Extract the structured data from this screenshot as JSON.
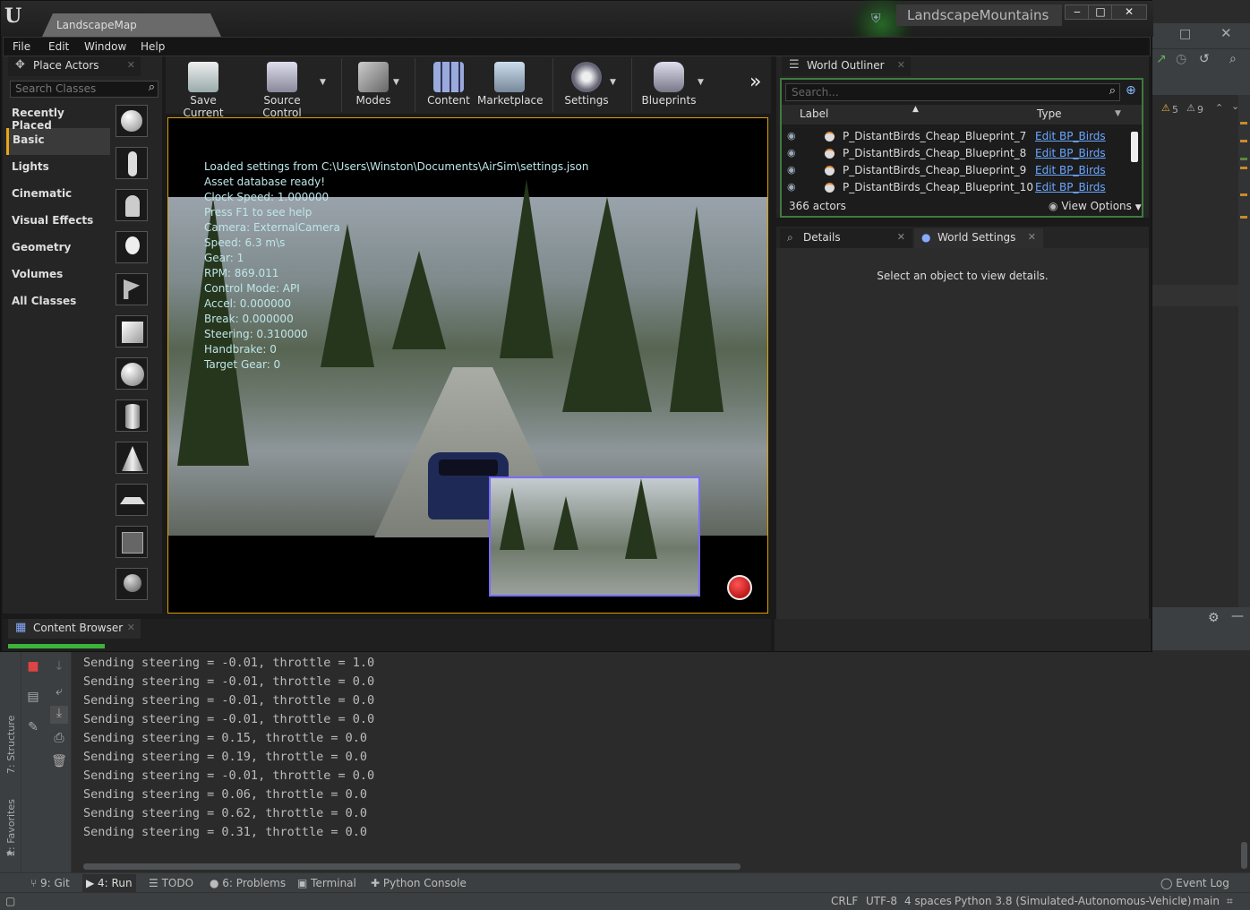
{
  "ue": {
    "tab_title": "LandscapeMap",
    "project_name": "LandscapeMountains",
    "window_controls": [
      "‒",
      "□",
      "✕"
    ],
    "menu": [
      "File",
      "Edit",
      "Window",
      "Help"
    ]
  },
  "place_actors": {
    "tab_label": "Place Actors",
    "search_placeholder": "Search Classes",
    "categories": [
      "Recently Placed",
      "Basic",
      "Lights",
      "Cinematic",
      "Visual Effects",
      "Geometry",
      "Volumes",
      "All Classes"
    ],
    "active_category": "Basic"
  },
  "toolbar": {
    "save_current": "Save Current",
    "source_control": "Source Control",
    "modes": "Modes",
    "content": "Content",
    "marketplace": "Marketplace",
    "settings": "Settings",
    "blueprints": "Blueprints",
    "more": "»"
  },
  "viewport": {
    "overlay_lines": [
      "Loaded settings from C:\\Users\\Winston\\Documents\\AirSim\\settings.json",
      "Asset database ready!",
      "Clock Speed: 1.000000",
      "Press F1 to see help",
      "Camera: ExternalCamera",
      "Speed: 6.3 m\\s",
      "Gear: 1",
      "RPM: 869.011",
      "Control Mode: API",
      "Accel: 0.000000",
      "Break: 0.000000",
      "Steering: 0.310000",
      "Handbrake: 0",
      "Target Gear: 0"
    ]
  },
  "outliner": {
    "tab_label": "World Outliner",
    "search_placeholder": "Search...",
    "col_label": "Label",
    "col_type": "Type",
    "rows": [
      {
        "label": "P_DistantBirds_Cheap_Blueprint_7",
        "type": "Edit BP_Birds"
      },
      {
        "label": "P_DistantBirds_Cheap_Blueprint_8",
        "type": "Edit BP_Birds"
      },
      {
        "label": "P_DistantBirds_Cheap_Blueprint_9",
        "type": "Edit BP_Birds"
      },
      {
        "label": "P_DistantBirds_Cheap_Blueprint_10",
        "type": "Edit BP_Birds"
      }
    ],
    "actors_count": "366 actors",
    "view_options": "View Options"
  },
  "details": {
    "tab_label": "Details",
    "world_settings_label": "World Settings",
    "empty_message": "Select an object to view details."
  },
  "content_browser": {
    "tab_label": "Content Browser"
  },
  "ide": {
    "inspection": {
      "warnings": "5",
      "weak_warnings": "9"
    },
    "console_lines": [
      "Sending steering = -0.01, throttle = 1.0",
      "Sending steering = -0.01, throttle = 0.0",
      "Sending steering = -0.01, throttle = 0.0",
      "Sending steering = -0.01, throttle = 0.0",
      "Sending steering = 0.15, throttle = 0.0",
      "Sending steering = 0.19, throttle = 0.0",
      "Sending steering = -0.01, throttle = 0.0",
      "Sending steering = 0.06, throttle = 0.0",
      "Sending steering = 0.62, throttle = 0.0",
      "Sending steering = 0.31, throttle = 0.0"
    ],
    "side_labels": {
      "structure": "7: Structure",
      "favorites": "2: Favorites"
    },
    "bottom_tabs": {
      "git": "9: Git",
      "run": "4: Run",
      "todo": "TODO",
      "problems": "6: Problems",
      "terminal": "Terminal",
      "python_console": "Python Console",
      "event_log": "Event Log"
    },
    "status": {
      "line_sep": "CRLF",
      "encoding": "UTF-8",
      "indent": "4 spaces",
      "interpreter": "Python 3.8 (Simulated-Autonomous-Vehicle)",
      "branch": "main"
    }
  }
}
